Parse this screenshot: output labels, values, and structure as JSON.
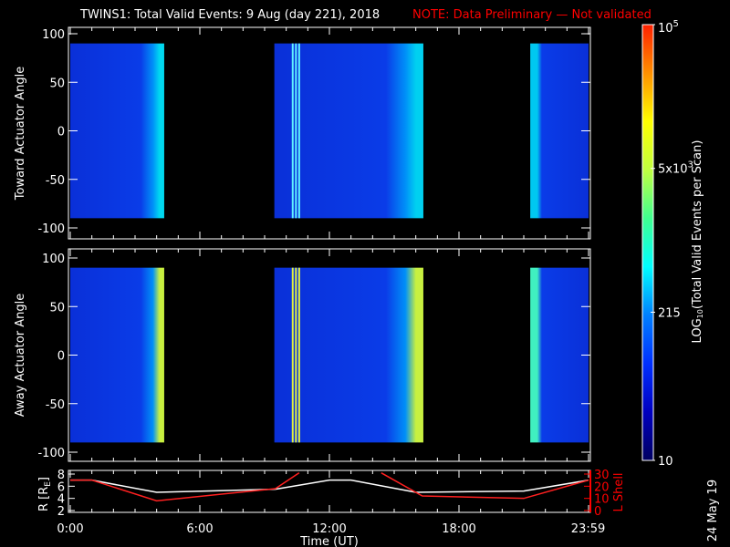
{
  "chart_data": {
    "type": "heatmap",
    "title": "TWINS1: Total Valid Events:  9 Aug (day 221), 2018",
    "note": "NOTE: Data Preliminary — Not validated",
    "date_stamp": "24 May 19",
    "xlabel": "Time (UT)",
    "xlim_hours": [
      0,
      24
    ],
    "x_ticks": [
      {
        "h": 0,
        "label": "0:00"
      },
      {
        "h": 6,
        "label": "6:00"
      },
      {
        "h": 12,
        "label": "12:00"
      },
      {
        "h": 18,
        "label": "18:00"
      },
      {
        "h": 23.98,
        "label": "23:59"
      }
    ],
    "panels": [
      {
        "ylabel": "Toward Actuator Angle",
        "ylim": [
          -100,
          100
        ],
        "y_ticks": [
          "100",
          "50",
          "0",
          "-50",
          "-100"
        ],
        "y_vals": [
          100,
          50,
          0,
          -50,
          -100
        ],
        "data_ylim": [
          -90,
          90
        ],
        "blocks": [
          {
            "start": 0.0,
            "end": 4.35,
            "edge": "#00d8f0"
          },
          {
            "start": 9.45,
            "end": 16.35,
            "edge": "#00d0f0",
            "streaks": [
              10.3,
              10.45,
              10.6
            ]
          },
          {
            "start": 21.3,
            "end": 24,
            "edge": "#00c8f0",
            "lead": true
          }
        ]
      },
      {
        "ylabel": "Away Actuator Angle",
        "ylim": [
          -100,
          100
        ],
        "y_ticks": [
          "100",
          "50",
          "0",
          "-50",
          "-100"
        ],
        "y_vals": [
          100,
          50,
          0,
          -50,
          -100
        ],
        "data_ylim": [
          -90,
          90
        ],
        "blocks": [
          {
            "start": 0.0,
            "end": 4.35,
            "edge": "#c8f040"
          },
          {
            "start": 9.45,
            "end": 16.35,
            "edge": "#c8f040",
            "streaks": [
              10.3,
              10.45,
              10.6
            ]
          },
          {
            "start": 21.3,
            "end": 24,
            "edge": "#40f0c0",
            "lead": true
          }
        ]
      }
    ],
    "orbit": {
      "left_label": "R [R",
      "left_sub": "E",
      "left_label_end": "]",
      "right_label": "L Shell",
      "left_ylim": [
        2,
        8
      ],
      "left_ticks": [
        "8",
        "6",
        "4",
        "2"
      ],
      "left_vals": [
        8,
        6,
        4,
        2
      ],
      "right_ylim": [
        0,
        30
      ],
      "right_ticks": [
        "30",
        "20",
        "10",
        "0"
      ],
      "right_vals": [
        30,
        20,
        10,
        0
      ],
      "R": {
        "color": "#ffffff",
        "points": [
          [
            0,
            7
          ],
          [
            1,
            7
          ],
          [
            4,
            5
          ],
          [
            9.5,
            5.5
          ],
          [
            12,
            7
          ],
          [
            13,
            7
          ],
          [
            16,
            5
          ],
          [
            21,
            5.2
          ],
          [
            24,
            7
          ]
        ]
      },
      "L": {
        "color": "#ff2020",
        "segments": [
          [
            [
              0,
              25
            ],
            [
              1,
              25
            ],
            [
              4,
              8
            ],
            [
              9.5,
              18
            ],
            [
              10.6,
              31
            ]
          ],
          [
            [
              14.4,
              31
            ],
            [
              16.3,
              12
            ],
            [
              21,
              10
            ],
            [
              24,
              25
            ]
          ]
        ]
      }
    },
    "colorbar": {
      "label": "LOG",
      "label_sub": "10",
      "label_rest": "(Total Valid Events per Scan)",
      "ticks": [
        {
          "label": "10",
          "frac": 0
        },
        {
          "label": "215",
          "frac": 0.34
        },
        {
          "label": "5x10",
          "sup": "3",
          "frac": 0.67
        },
        {
          "label": "10",
          "sup": "5",
          "frac": 1
        }
      ],
      "stops": [
        "#000060",
        "#0000c0",
        "#0030ff",
        "#0080ff",
        "#00ffff",
        "#40ff90",
        "#c0ff40",
        "#ffff00",
        "#ff9000",
        "#ff2000"
      ]
    },
    "colors": {
      "background": "#000000",
      "axis": "#ffffff",
      "note": "#ff0000",
      "base_blue": "#0a3ce8"
    }
  }
}
